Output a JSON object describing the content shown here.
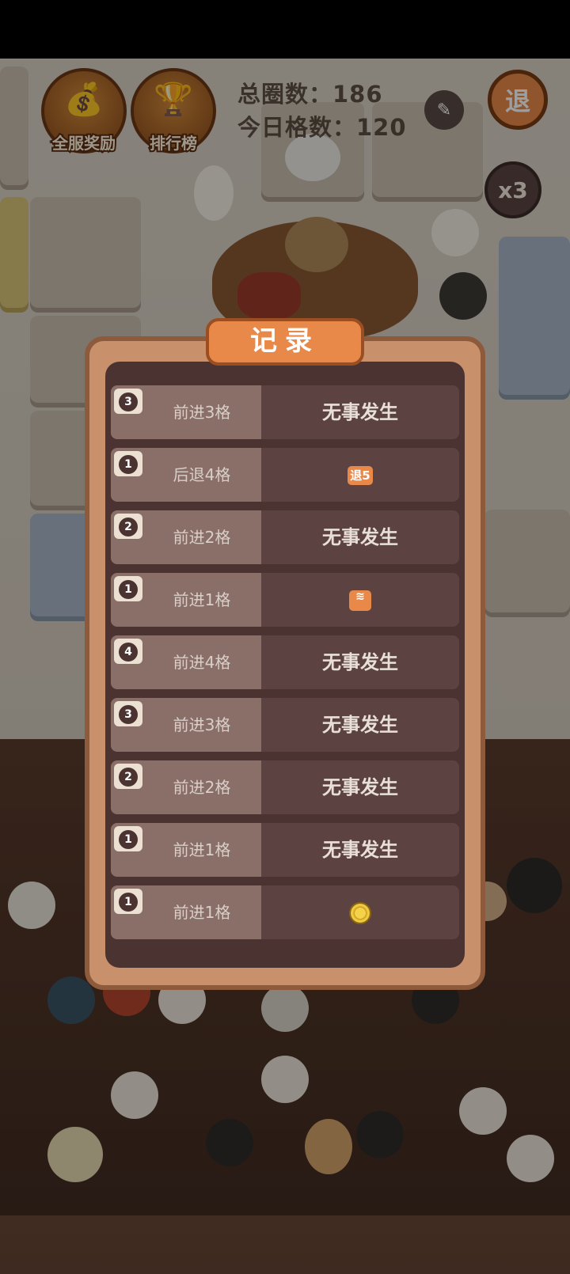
{
  "header": {
    "server_reward_label": "全服奖励",
    "ranking_label": "排行榜",
    "total_laps": "总圈数：186",
    "today_steps": "今日格数：120",
    "retreat_label": "退",
    "multiplier": "x3"
  },
  "dialog": {
    "title": "记录",
    "records": [
      {
        "dice": "3",
        "step": "前进3格",
        "result": "无事发生",
        "result_type": "text"
      },
      {
        "dice": "1",
        "step": "后退4格",
        "result": "退5",
        "result_type": "retreat-badge"
      },
      {
        "dice": "2",
        "step": "前进2格",
        "result": "无事发生",
        "result_type": "text"
      },
      {
        "dice": "1",
        "step": "前进1格",
        "result": "≋",
        "result_type": "wave-icon"
      },
      {
        "dice": "4",
        "step": "前进4格",
        "result": "无事发生",
        "result_type": "text"
      },
      {
        "dice": "3",
        "step": "前进3格",
        "result": "无事发生",
        "result_type": "text"
      },
      {
        "dice": "2",
        "step": "前进2格",
        "result": "无事发生",
        "result_type": "text"
      },
      {
        "dice": "1",
        "step": "前进1格",
        "result": "无事发生",
        "result_type": "text"
      },
      {
        "dice": "1",
        "step": "前进1格",
        "result": "",
        "result_type": "coin-icon"
      }
    ]
  },
  "colors": {
    "panel_frame": "#c8906b",
    "panel_inner": "#4a3331",
    "title_bg": "#e8894a",
    "accent": "#e8894a"
  }
}
